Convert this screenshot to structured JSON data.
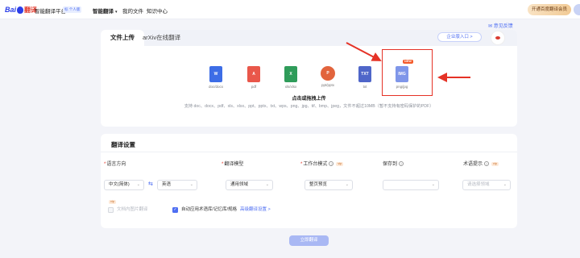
{
  "header": {
    "logo_text": "Bai",
    "logo_cn": "翻译",
    "product_name": "智能翻译平台",
    "version_badge": "标 个人版",
    "nav_items": [
      {
        "label": "智能翻译",
        "active": true
      },
      {
        "label": "我的文件",
        "active": false
      },
      {
        "label": "知识中心",
        "active": false
      }
    ],
    "vip_button": "开通百度翻译会员"
  },
  "feedback_link": "意见反馈",
  "upload": {
    "tabs": [
      "文件上传",
      "arXiv在线翻译"
    ],
    "enterprise_button": "企业版入口 >",
    "file_types": [
      {
        "icon": "word-file-icon",
        "glyph": "W",
        "ext": "doc/docx"
      },
      {
        "icon": "pdf-file-icon",
        "glyph": "A",
        "ext": "pdf"
      },
      {
        "icon": "excel-file-icon",
        "glyph": "X",
        "ext": "xls/xlsx"
      },
      {
        "icon": "powerpoint-file-icon",
        "glyph": "P",
        "ext": "ppt/pptx"
      },
      {
        "icon": "txt-file-icon",
        "glyph": "TXT",
        "ext": "txt"
      },
      {
        "icon": "image-file-icon",
        "glyph": "IMG",
        "ext": "png/jpg"
      }
    ],
    "new_badge": "NEW",
    "drop_title": "点击或拖拽上传",
    "drop_subtitle": "支持 doc、docx、pdf、xls、xlsx、ppt、pptx、txt、wps、png、jpg、tif、bmp、jpeg，文件不超过10MB（暂不支持有密码保护的PDF）"
  },
  "settings": {
    "title": "翻译设置",
    "labels": {
      "direction": "语言方向",
      "model": "翻译模型",
      "mode": "工作台模式",
      "save_to": "保存到",
      "term_hint": "术语提示"
    },
    "vip_tag": "vip",
    "source_lang": "中文(简体)",
    "target_lang": "英语",
    "model_value": "通用领域",
    "mode_value": "整页预览",
    "save_value": "",
    "term_placeholder": "请选择领域",
    "image_translate_label": "文档内图片翻译",
    "auto_apply_label": "自动应用术语库/记忆库/规格",
    "advanced_link": "高级翻译设置 >"
  },
  "translate_button": "立即翻译",
  "colors": {
    "accent": "#4e6ef2",
    "highlight": "#e53226",
    "background": "#f3f4f9"
  }
}
